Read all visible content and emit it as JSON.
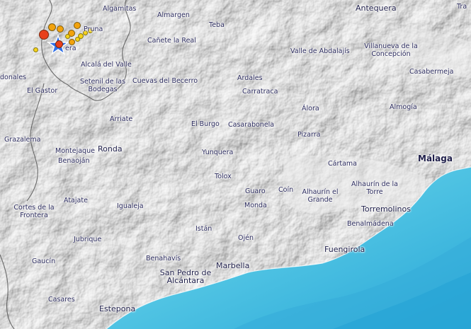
{
  "places": [
    {
      "id": "algamitas",
      "name": "Algamitas",
      "size": "s"
    },
    {
      "id": "almargen",
      "name": "Almargen",
      "size": "s"
    },
    {
      "id": "teba",
      "name": "Teba",
      "size": "s"
    },
    {
      "id": "antequera",
      "name": "Antequera",
      "size": "m"
    },
    {
      "id": "tra",
      "name": "Tra",
      "size": "s"
    },
    {
      "id": "pruna",
      "name": "Pruna",
      "size": "s"
    },
    {
      "id": "canete",
      "name": "Cañete la Real",
      "size": "s"
    },
    {
      "id": "valle-abdalajis",
      "name": "Valle de Abdalajís",
      "size": "s"
    },
    {
      "id": "villanueva",
      "name": "Villanueva de la Concepción",
      "size": "s"
    },
    {
      "id": "olvera",
      "name": "era",
      "size": "s"
    },
    {
      "id": "donales",
      "name": "donales",
      "size": "s"
    },
    {
      "id": "alcala-valle",
      "name": "Alcalá del Valle",
      "size": "s"
    },
    {
      "id": "cuevas-becerro",
      "name": "Cuevas del Becerro",
      "size": "s"
    },
    {
      "id": "ardales",
      "name": "Ardales",
      "size": "s"
    },
    {
      "id": "casabermeja",
      "name": "Casabermeja",
      "size": "s"
    },
    {
      "id": "el-gastor",
      "name": "El Gastor",
      "size": "s"
    },
    {
      "id": "setenil",
      "name": "Setenil de las Bodegas",
      "size": "s"
    },
    {
      "id": "carratraca",
      "name": "Carratraca",
      "size": "s"
    },
    {
      "id": "alora",
      "name": "Álora",
      "size": "s"
    },
    {
      "id": "almogia",
      "name": "Almogía",
      "size": "s"
    },
    {
      "id": "arriate",
      "name": "Arriate",
      "size": "s"
    },
    {
      "id": "el-burgo",
      "name": "El Burgo",
      "size": "s"
    },
    {
      "id": "casarabonela",
      "name": "Casarabonela",
      "size": "s"
    },
    {
      "id": "grazalema",
      "name": "Grazalema",
      "size": "s"
    },
    {
      "id": "pizarra",
      "name": "Pizarra",
      "size": "s"
    },
    {
      "id": "montejaque",
      "name": "Montejaque",
      "size": "s"
    },
    {
      "id": "ronda",
      "name": "Ronda",
      "size": "m"
    },
    {
      "id": "benaojan",
      "name": "Benaoján",
      "size": "s"
    },
    {
      "id": "yunquera",
      "name": "Yunquera",
      "size": "s"
    },
    {
      "id": "cartama",
      "name": "Cártama",
      "size": "s"
    },
    {
      "id": "malaga",
      "name": "Málaga",
      "size": "l"
    },
    {
      "id": "tolox",
      "name": "Tolox",
      "size": "s"
    },
    {
      "id": "guaro",
      "name": "Guaro",
      "size": "s"
    },
    {
      "id": "coin",
      "name": "Coín",
      "size": "s"
    },
    {
      "id": "alhaurin-grande",
      "name": "Alhaurín el Grande",
      "size": "s"
    },
    {
      "id": "alhaurin-torre",
      "name": "Alhaurín de la Torre",
      "size": "s"
    },
    {
      "id": "cortes",
      "name": "Cortes de la Frontera",
      "size": "s"
    },
    {
      "id": "atajate",
      "name": "Atajate",
      "size": "s"
    },
    {
      "id": "igualeja",
      "name": "Igualeja",
      "size": "s"
    },
    {
      "id": "monda",
      "name": "Monda",
      "size": "s"
    },
    {
      "id": "torremolinos",
      "name": "Torremolinos",
      "size": "m"
    },
    {
      "id": "istan",
      "name": "Istán",
      "size": "s"
    },
    {
      "id": "benalmadena",
      "name": "Benalmádena",
      "size": "s"
    },
    {
      "id": "jubrique",
      "name": "Jubrique",
      "size": "s"
    },
    {
      "id": "ojen",
      "name": "Ojén",
      "size": "s"
    },
    {
      "id": "fuengirola",
      "name": "Fuengirola",
      "size": "m"
    },
    {
      "id": "benahavis",
      "name": "Benahavís",
      "size": "s"
    },
    {
      "id": "gaucin",
      "name": "Gaucín",
      "size": "s"
    },
    {
      "id": "san-pedro",
      "name": "San Pedro de Alcántara",
      "size": "m"
    },
    {
      "id": "marbella",
      "name": "Marbella",
      "size": "m"
    },
    {
      "id": "casares",
      "name": "Casares",
      "size": "s"
    },
    {
      "id": "estepona",
      "name": "Estepona",
      "size": "m"
    }
  ],
  "colors": {
    "sea": "#4fc3e3",
    "sea_deep": "#29a6d6",
    "land": "#d2d2d2",
    "border": "#5a5a5a",
    "label": "#2b2b5e",
    "epicenter_star": "#2f6fe8",
    "quake_large": "#e8401c",
    "quake_medium": "#f2a20c",
    "quake_small": "#f5d21a"
  },
  "epicenter": {
    "icon": "star-icon"
  }
}
